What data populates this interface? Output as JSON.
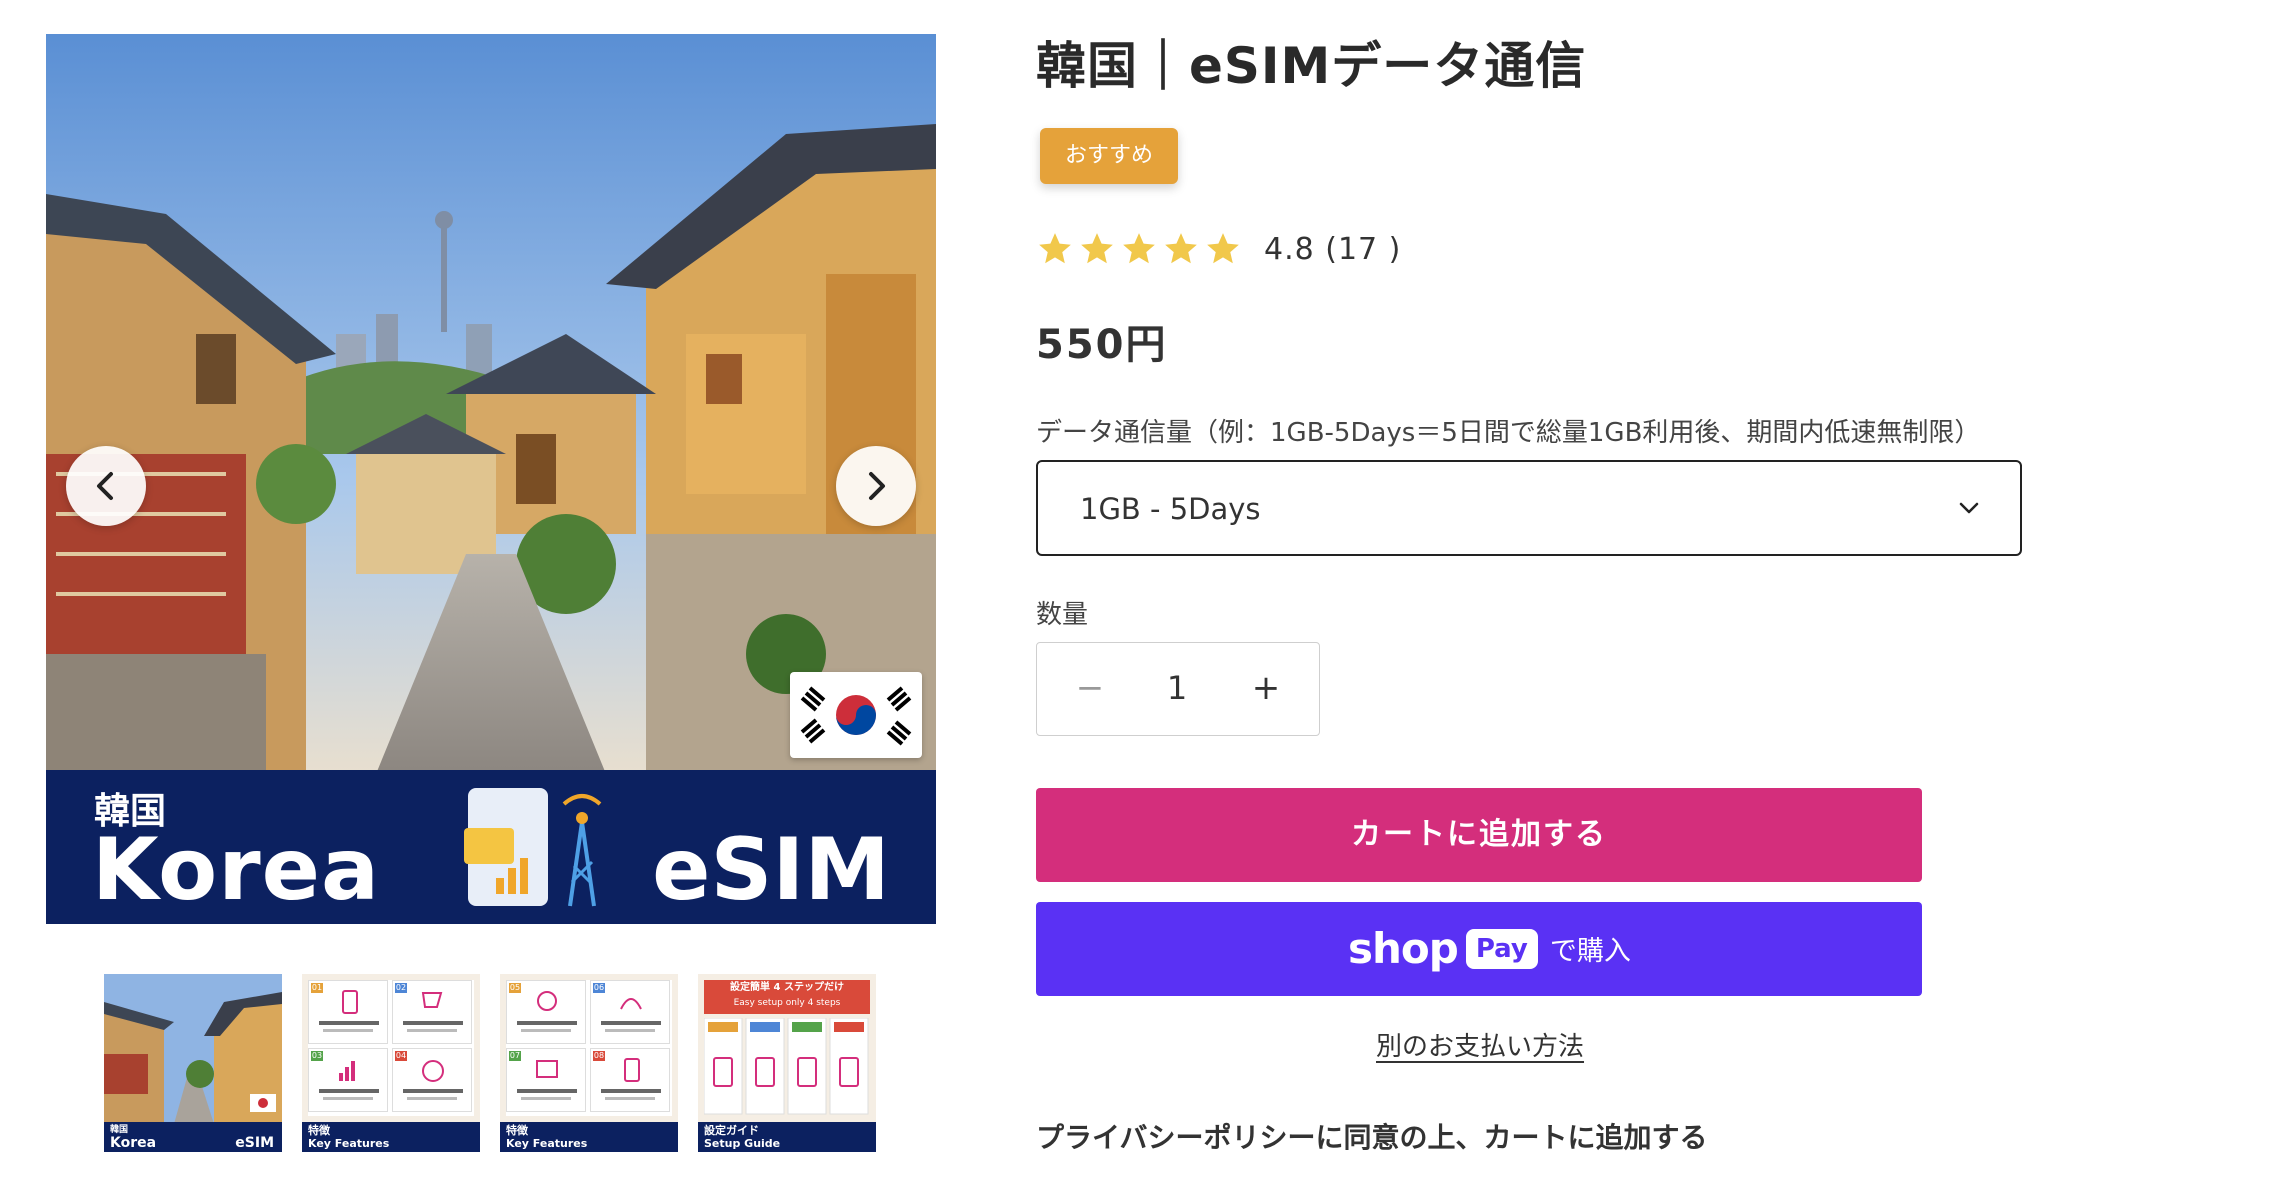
{
  "product": {
    "title": "韓国｜eSIMデータ通信",
    "badge": "おすすめ",
    "rating_text": "4.8 (17 )",
    "price": "550円"
  },
  "gallery": {
    "banner_small": "韓国",
    "banner_big": "Korea",
    "banner_esim": "eSIM",
    "thumbs": [
      {
        "foot_line1": "韓国",
        "foot_line2": "Korea",
        "foot_line3": "eSIM"
      },
      {
        "foot_line1": "特徴",
        "foot_line2": "Key Features"
      },
      {
        "foot_line1": "特徴",
        "foot_line2": "Key Features"
      },
      {
        "foot_line1": "設定ガイド",
        "foot_line2": "Setup Guide",
        "header": "設定簡単 4 ステップだけ",
        "subheader": "Easy setup only 4 steps"
      }
    ]
  },
  "variant": {
    "label": "データ通信量（例：1GB-5Days＝5日間で総量1GB利用後、期間内低速無制限）",
    "selected": "1GB - 5Days"
  },
  "quantity": {
    "label": "数量",
    "minus": "−",
    "value": "1",
    "plus": "+"
  },
  "buttons": {
    "add_to_cart": "カートに追加する",
    "shop_word": "shop",
    "pay_pill": "Pay",
    "shop_tail": "で購入",
    "other_payment": "別のお支払い方法"
  },
  "privacy_note": "プライバシーポリシーに同意の上、カートに追加する",
  "colors": {
    "cart": "#d42e7c",
    "shop_pay": "#5a31f4",
    "badge": "#e5a23a",
    "star": "#f1c84b",
    "banner": "#0c2160"
  },
  "icons": {
    "prev": "chevron-left-icon",
    "next": "chevron-right-icon",
    "select": "chevron-down-icon",
    "star": "star-icon"
  }
}
